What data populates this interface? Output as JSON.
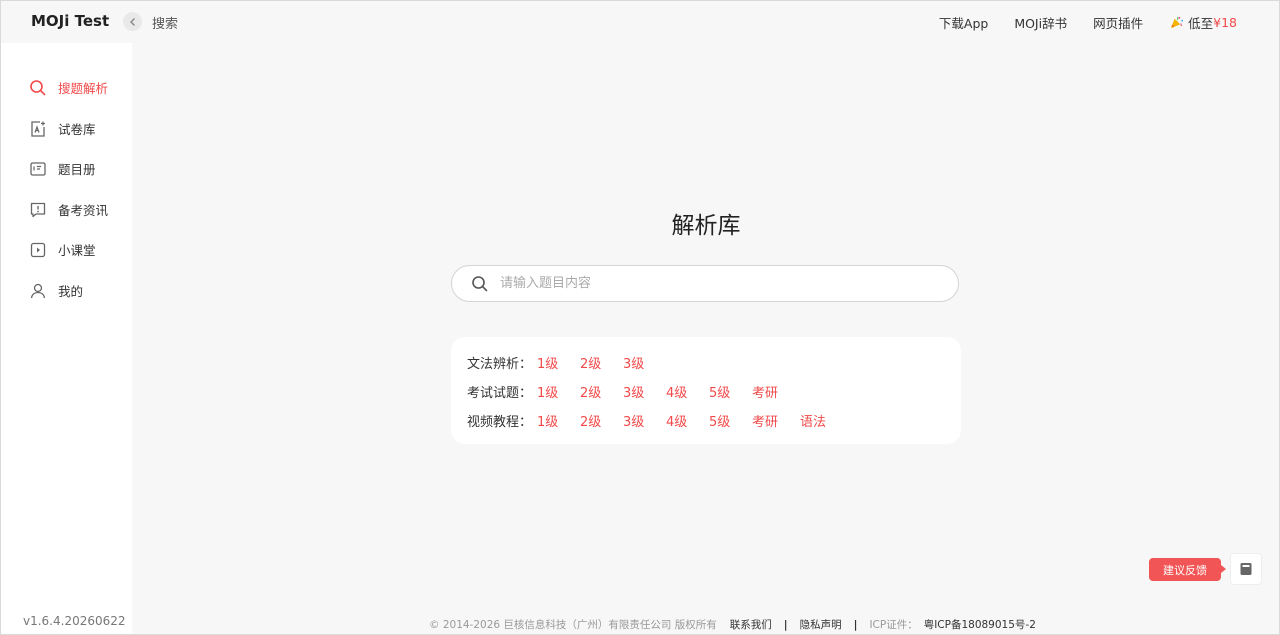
{
  "header": {
    "logo": "MOJi Test",
    "breadcrumb": "搜索",
    "nav": [
      "下载App",
      "MOJi辞书",
      "网页插件"
    ],
    "promo_prefix": "低至",
    "promo_price": "¥18"
  },
  "sidebar": {
    "items": [
      {
        "label": "搜题解析",
        "icon": "search-icon",
        "active": true
      },
      {
        "label": "试卷库",
        "icon": "exam-paper-icon"
      },
      {
        "label": "题目册",
        "icon": "question-book-icon"
      },
      {
        "label": "备考资讯",
        "icon": "news-icon"
      },
      {
        "label": "小课堂",
        "icon": "classroom-icon"
      },
      {
        "label": "我的",
        "icon": "user-icon"
      }
    ],
    "version": "v1.6.4.20260622"
  },
  "main": {
    "title": "解析库",
    "search_placeholder": "请输入题目内容",
    "categories": [
      {
        "label": "文法辨析：",
        "levels": [
          "1级",
          "2级",
          "3级"
        ]
      },
      {
        "label": "考试试题：",
        "levels": [
          "1级",
          "2级",
          "3级",
          "4级",
          "5级",
          "考研"
        ]
      },
      {
        "label": "视频教程：",
        "levels": [
          "1级",
          "2级",
          "3级",
          "4级",
          "5级",
          "考研",
          "语法"
        ]
      }
    ]
  },
  "feedback": {
    "label": "建议反馈",
    "icon": "notebook-icon"
  },
  "footer": {
    "copyright": "© 2014-2026 巨核信息科技（广州）有限责任公司 版权所有",
    "contact": "联系我们",
    "privacy": "隐私声明",
    "icp_label": "ICP证件：",
    "icp_number": "粤ICP备18089015号-2"
  },
  "colors": {
    "accent": "#f24a4a",
    "feedback": "#f25555"
  }
}
